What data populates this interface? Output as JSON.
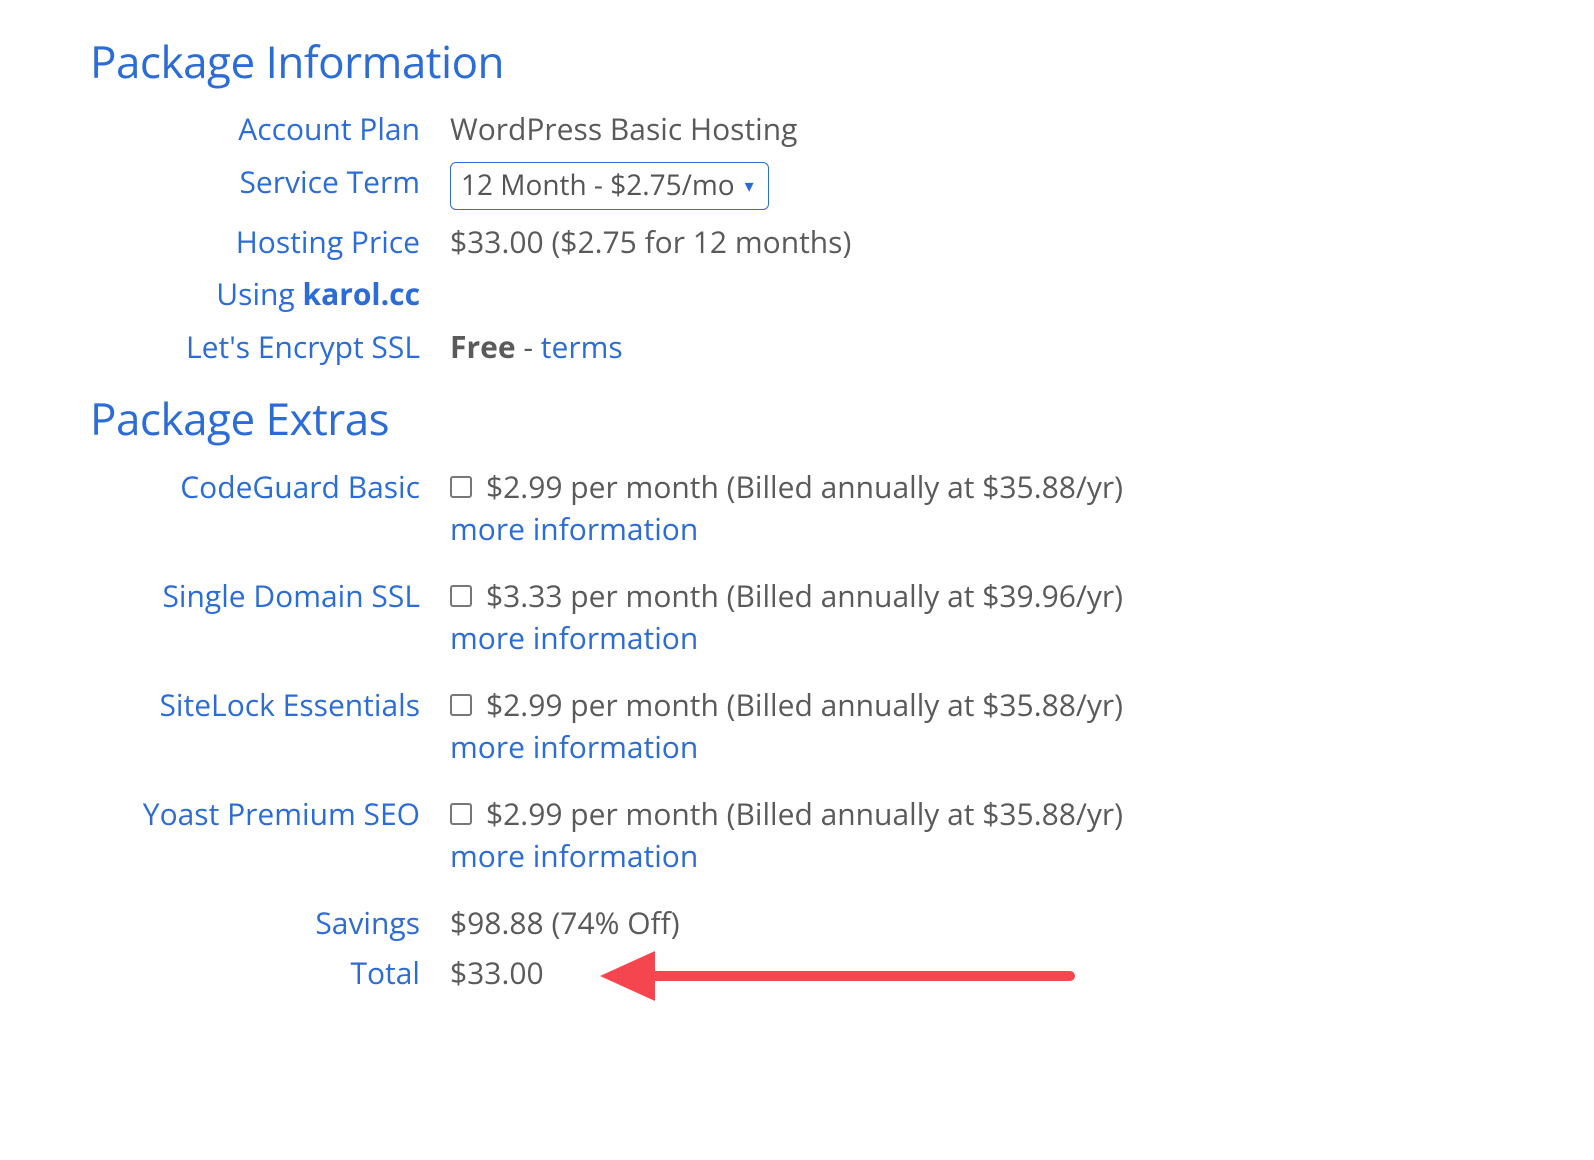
{
  "sections": {
    "info_title": "Package Information",
    "extras_title": "Package Extras"
  },
  "info": {
    "account_plan_label": "Account Plan",
    "account_plan_value": "WordPress Basic Hosting",
    "service_term_label": "Service Term",
    "service_term_selected": "12 Month - $2.75/mo",
    "hosting_price_label": "Hosting Price",
    "hosting_price_value": "$33.00 ($2.75 for 12 months)",
    "using_label_prefix": "Using ",
    "using_domain": "karol.cc",
    "ssl_label": "Let's Encrypt SSL",
    "ssl_free": "Free",
    "ssl_sep": " - ",
    "ssl_terms": "terms"
  },
  "extras": [
    {
      "label": "CodeGuard Basic",
      "desc": "$2.99 per month (Billed annually at $35.88/yr)",
      "more": "more information"
    },
    {
      "label": "Single Domain SSL",
      "desc": "$3.33 per month (Billed annually at $39.96/yr)",
      "more": "more information"
    },
    {
      "label": "SiteLock Essentials",
      "desc": "$2.99 per month (Billed annually at $35.88/yr)",
      "more": "more information"
    },
    {
      "label": "Yoast Premium SEO",
      "desc": "$2.99 per month (Billed annually at $35.88/yr)",
      "more": "more information"
    }
  ],
  "summary": {
    "savings_label": "Savings",
    "savings_value": "$98.88 (74% Off)",
    "total_label": "Total",
    "total_value": "$33.00"
  },
  "colors": {
    "accent": "#2c6cd6",
    "arrow": "#f5464f"
  }
}
